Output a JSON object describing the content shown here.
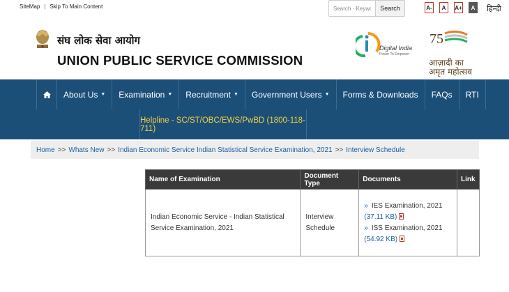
{
  "topbar": {
    "sitemap": "SiteMap",
    "separator": "|",
    "skip": "Skip To Main Content",
    "search_placeholder": "Search - Keyword",
    "search_button": "Search",
    "font_sizes": [
      "A-",
      "A",
      "A+",
      "A"
    ],
    "language": "हिन्दी"
  },
  "header": {
    "org_hindi": "संघ लोक सेवा आयोग",
    "org_name": "UNION PUBLIC SERVICE COMMISSION",
    "digital_india": "Digital India",
    "digital_india_tagline": "Power To Empower",
    "azadi_number": "75",
    "azadi_text": "आज़ादी का अमृत महोत्सव"
  },
  "nav": {
    "items": [
      {
        "label": "About Us",
        "dropdown": true
      },
      {
        "label": "Examination",
        "dropdown": true
      },
      {
        "label": "Recruitment",
        "dropdown": true
      },
      {
        "label": "Government Users",
        "dropdown": true
      },
      {
        "label": "Forms & Downloads",
        "dropdown": false
      },
      {
        "label": "FAQs",
        "dropdown": false
      },
      {
        "label": "RTI",
        "dropdown": false
      }
    ],
    "helpline": "Helpline - SC/ST/OBC/EWS/PwBD (1800-118-711)"
  },
  "breadcrumb": {
    "items": [
      "Home",
      "Whats New",
      "Indian Economic Service Indian Statistical Service Examination, 2021",
      "Interview Schedule"
    ],
    "separator": ">>"
  },
  "table": {
    "headers": [
      "Name of Examination",
      "Document Type",
      "Documents",
      "Link"
    ],
    "row": {
      "name": "Indian Economic Service - Indian Statistical Service Examination, 2021",
      "doc_type": "Interview Schedule",
      "documents": [
        {
          "title": "IES Examination, 2021",
          "size": "(37.11 KB)"
        },
        {
          "title": "ISS Examination, 2021",
          "size": "(54.92 KB)"
        }
      ],
      "link": ""
    }
  },
  "colors": {
    "nav_bg": "#1c4f78",
    "helpline": "#f4d03f",
    "link": "#1a5fa0",
    "table_header": "#3a3a3a"
  }
}
